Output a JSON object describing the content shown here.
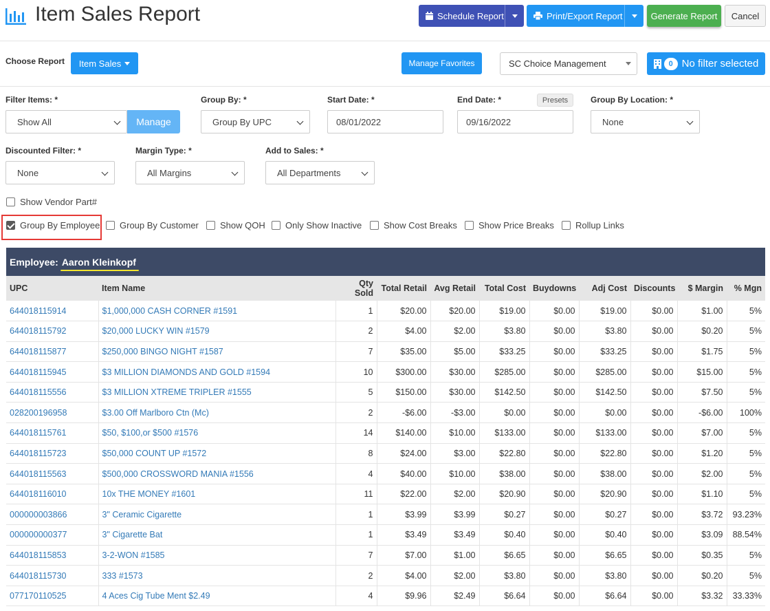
{
  "header": {
    "title": "Item Sales Report",
    "schedule_label": "Schedule Report",
    "print_label": "Print/Export Report",
    "generate_label": "Generate Report",
    "cancel_label": "Cancel"
  },
  "toolbar": {
    "choose_label": "Choose Report",
    "report_select": "Item Sales",
    "favorites_label": "Manage Favorites",
    "management_select": "SC Choice Management",
    "filter_count": "0",
    "filter_label": "No filter selected"
  },
  "filters": {
    "filter_items_label": "Filter Items: *",
    "filter_items_value": "Show All",
    "manage_label": "Manage",
    "group_by_label": "Group By: *",
    "group_by_value": "Group By UPC",
    "start_date_label": "Start Date: *",
    "start_date_value": "08/01/2022",
    "end_date_label": "End Date: *",
    "end_date_value": "09/16/2022",
    "presets_label": "Presets",
    "group_location_label": "Group By Location: *",
    "group_location_value": "None",
    "discounted_label": "Discounted Filter: *",
    "discounted_value": "None",
    "margin_label": "Margin Type: *",
    "margin_value": "All Margins",
    "add_sales_label": "Add to Sales: *",
    "add_sales_value": "All Departments"
  },
  "options": {
    "vendor_part": "Show Vendor Part#",
    "group_employee": "Group By Employee",
    "group_customer": "Group By Customer",
    "show_qoh": "Show QOH",
    "only_inactive": "Only Show Inactive",
    "cost_breaks": "Show Cost Breaks",
    "price_breaks": "Show Price Breaks",
    "rollup": "Rollup Links"
  },
  "report": {
    "employee_label": "Employee:",
    "employee_name": "Aaron Kleinkopf",
    "columns": [
      "UPC",
      "Item Name",
      "Qty Sold",
      "Total Retail",
      "Avg Retail",
      "Total Cost",
      "Buydowns",
      "Adj Cost",
      "Discounts",
      "$ Margin",
      "% Mgn"
    ],
    "rows": [
      [
        "644018115914",
        "$1,000,000 CASH CORNER #1591",
        "1",
        "$20.00",
        "$20.00",
        "$19.00",
        "$0.00",
        "$19.00",
        "$0.00",
        "$1.00",
        "5%"
      ],
      [
        "644018115792",
        "$20,000 LUCKY WIN #1579",
        "2",
        "$4.00",
        "$2.00",
        "$3.80",
        "$0.00",
        "$3.80",
        "$0.00",
        "$0.20",
        "5%"
      ],
      [
        "644018115877",
        "$250,000 BINGO NIGHT #1587",
        "7",
        "$35.00",
        "$5.00",
        "$33.25",
        "$0.00",
        "$33.25",
        "$0.00",
        "$1.75",
        "5%"
      ],
      [
        "644018115945",
        "$3 MILLION DIAMONDS AND GOLD #1594",
        "10",
        "$300.00",
        "$30.00",
        "$285.00",
        "$0.00",
        "$285.00",
        "$0.00",
        "$15.00",
        "5%"
      ],
      [
        "644018115556",
        "$3 MILLION XTREME TRIPLER #1555",
        "5",
        "$150.00",
        "$30.00",
        "$142.50",
        "$0.00",
        "$142.50",
        "$0.00",
        "$7.50",
        "5%"
      ],
      [
        "028200196958",
        "$3.00 Off Marlboro Ctn (Mc)",
        "2",
        "-$6.00",
        "-$3.00",
        "$0.00",
        "$0.00",
        "$0.00",
        "$0.00",
        "-$6.00",
        "100%"
      ],
      [
        "644018115761",
        "$50, $100,or $500 #1576",
        "14",
        "$140.00",
        "$10.00",
        "$133.00",
        "$0.00",
        "$133.00",
        "$0.00",
        "$7.00",
        "5%"
      ],
      [
        "644018115723",
        "$50,000 COUNT UP #1572",
        "8",
        "$24.00",
        "$3.00",
        "$22.80",
        "$0.00",
        "$22.80",
        "$0.00",
        "$1.20",
        "5%"
      ],
      [
        "644018115563",
        "$500,000 CROSSWORD MANIA #1556",
        "4",
        "$40.00",
        "$10.00",
        "$38.00",
        "$0.00",
        "$38.00",
        "$0.00",
        "$2.00",
        "5%"
      ],
      [
        "644018116010",
        "10x THE MONEY #1601",
        "11",
        "$22.00",
        "$2.00",
        "$20.90",
        "$0.00",
        "$20.90",
        "$0.00",
        "$1.10",
        "5%"
      ],
      [
        "000000003866",
        "3\" Ceramic Cigarette",
        "1",
        "$3.99",
        "$3.99",
        "$0.27",
        "$0.00",
        "$0.27",
        "$0.00",
        "$3.72",
        "93.23%"
      ],
      [
        "000000000377",
        "3\" Cigarette Bat",
        "1",
        "$3.49",
        "$3.49",
        "$0.40",
        "$0.00",
        "$0.40",
        "$0.00",
        "$3.09",
        "88.54%"
      ],
      [
        "644018115853",
        "3-2-WON #1585",
        "7",
        "$7.00",
        "$1.00",
        "$6.65",
        "$0.00",
        "$6.65",
        "$0.00",
        "$0.35",
        "5%"
      ],
      [
        "644018115730",
        "333 #1573",
        "2",
        "$4.00",
        "$2.00",
        "$3.80",
        "$0.00",
        "$3.80",
        "$0.00",
        "$0.20",
        "5%"
      ],
      [
        "077170110525",
        "4 Aces Cig Tube Ment $2.49",
        "4",
        "$9.96",
        "$2.49",
        "$6.64",
        "$0.00",
        "$6.64",
        "$0.00",
        "$3.32",
        "33.33%"
      ]
    ]
  }
}
